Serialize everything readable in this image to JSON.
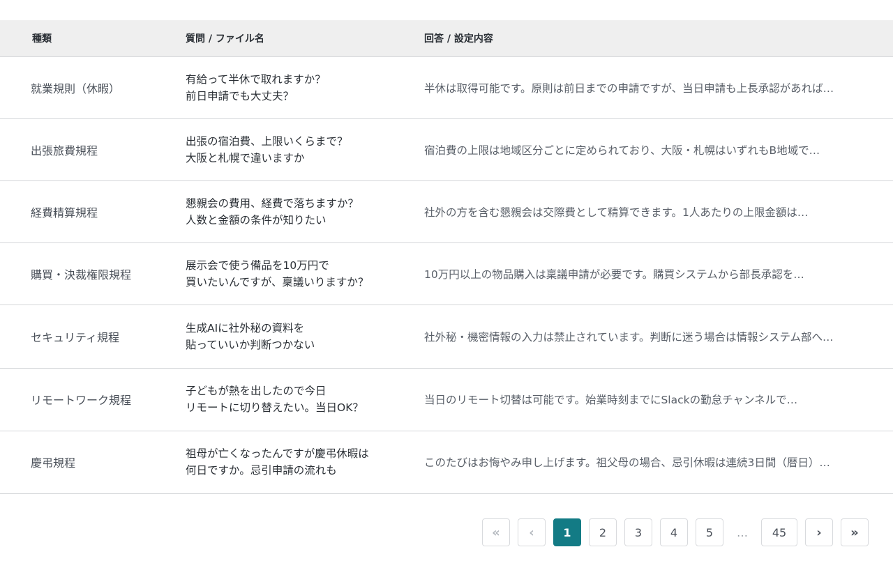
{
  "table": {
    "headers": [
      "種類",
      "質問 / ファイル名",
      "回答 / 設定内容"
    ],
    "rows": [
      {
        "type": "就業規則（休暇）",
        "question": [
          "有給って半休で取れますか？",
          "前日申請でも大丈夫？"
        ],
        "answer": "半休は取得可能です。原則は前日までの申請ですが、当日申請も上長承認があれば…"
      },
      {
        "type": "出張旅費規程",
        "question": [
          "出張の宿泊費、上限いくらまで？",
          "大阪と札幌で違いますか"
        ],
        "answer": "宿泊費の上限は地域区分ごとに定められており、大阪・札幌はいずれもB地域で…"
      },
      {
        "type": "経費精算規程",
        "question": [
          "懇親会の費用、経費で落ちますか？",
          "人数と金額の条件が知りたい"
        ],
        "answer": "社外の方を含む懇親会は交際費として精算できます。1人あたりの上限金額は…"
      },
      {
        "type": "購買・決裁権限規程",
        "question": [
          "展示会で使う備品を10万円で",
          "買いたいんですが、稟議いりますか？"
        ],
        "answer": "10万円以上の物品購入は稟議申請が必要です。購買システムから部長承認を…"
      },
      {
        "type": "セキュリティ規程",
        "question": [
          "生成AIに社外秘の資料を",
          "貼っていいか判断つかない"
        ],
        "answer": "社外秘・機密情報の入力は禁止されています。判断に迷う場合は情報システム部へ…"
      },
      {
        "type": "リモートワーク規程",
        "question": [
          "子どもが熱を出したので今日",
          "リモートに切り替えたい。当日OK？"
        ],
        "answer": "当日のリモート切替は可能です。始業時刻までにSlackの勤怠チャンネルで…"
      },
      {
        "type": "慶弔規程",
        "question": [
          "祖母が亡くなったんですが慶弔休暇は",
          "何日ですか。忌引申請の流れも"
        ],
        "answer": "このたびはお悔やみ申し上げます。祖父母の場合、忌引休暇は連続3日間（暦日）…"
      }
    ]
  },
  "pagination": {
    "first_icon": "«",
    "prev_icon": "‹",
    "next_icon": "›",
    "last_icon": "»",
    "pages": [
      "1",
      "2",
      "3",
      "4",
      "5"
    ],
    "ellipsis": "…",
    "last_page": "45",
    "current_page": "1",
    "active_color": "#137b85"
  }
}
